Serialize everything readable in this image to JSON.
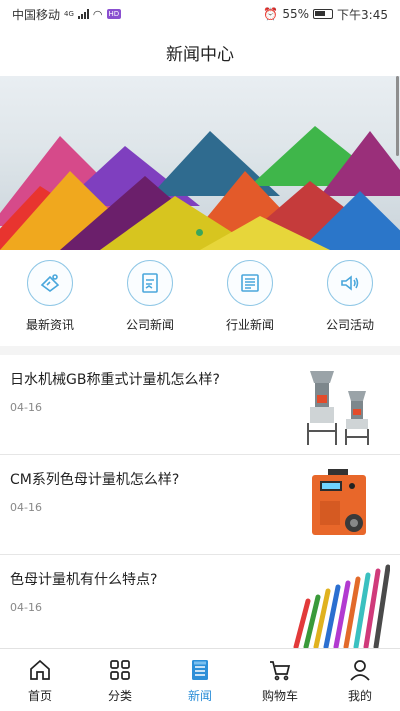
{
  "status_bar": {
    "carrier": "中国移动",
    "network": "4G",
    "battery": "55%",
    "time": "下午3:45"
  },
  "header": {
    "title": "新闻中心"
  },
  "categories": [
    {
      "label": "最新资讯",
      "icon": "announcement-icon"
    },
    {
      "label": "公司新闻",
      "icon": "document-icon"
    },
    {
      "label": "行业新闻",
      "icon": "newspaper-icon"
    },
    {
      "label": "公司活动",
      "icon": "speaker-icon"
    }
  ],
  "news": [
    {
      "title": "日水机械GB称重式计量机怎么样?",
      "date": "04-16",
      "thumb": "dosing-machine-image"
    },
    {
      "title": "CM系列色母计量机怎么样?",
      "date": "04-16",
      "thumb": "color-doser-image"
    },
    {
      "title": "色母计量机有什么特点?",
      "date": "04-16",
      "thumb": "colored-cables-image"
    }
  ],
  "tabs": [
    {
      "label": "首页",
      "icon": "home-icon"
    },
    {
      "label": "分类",
      "icon": "grid-icon"
    },
    {
      "label": "新闻",
      "icon": "news-icon",
      "active": true
    },
    {
      "label": "购物车",
      "icon": "cart-icon"
    },
    {
      "label": "我的",
      "icon": "user-icon"
    }
  ],
  "colors": {
    "accent": "#2d8fd8",
    "icon_outline": "#8fc7e6"
  }
}
